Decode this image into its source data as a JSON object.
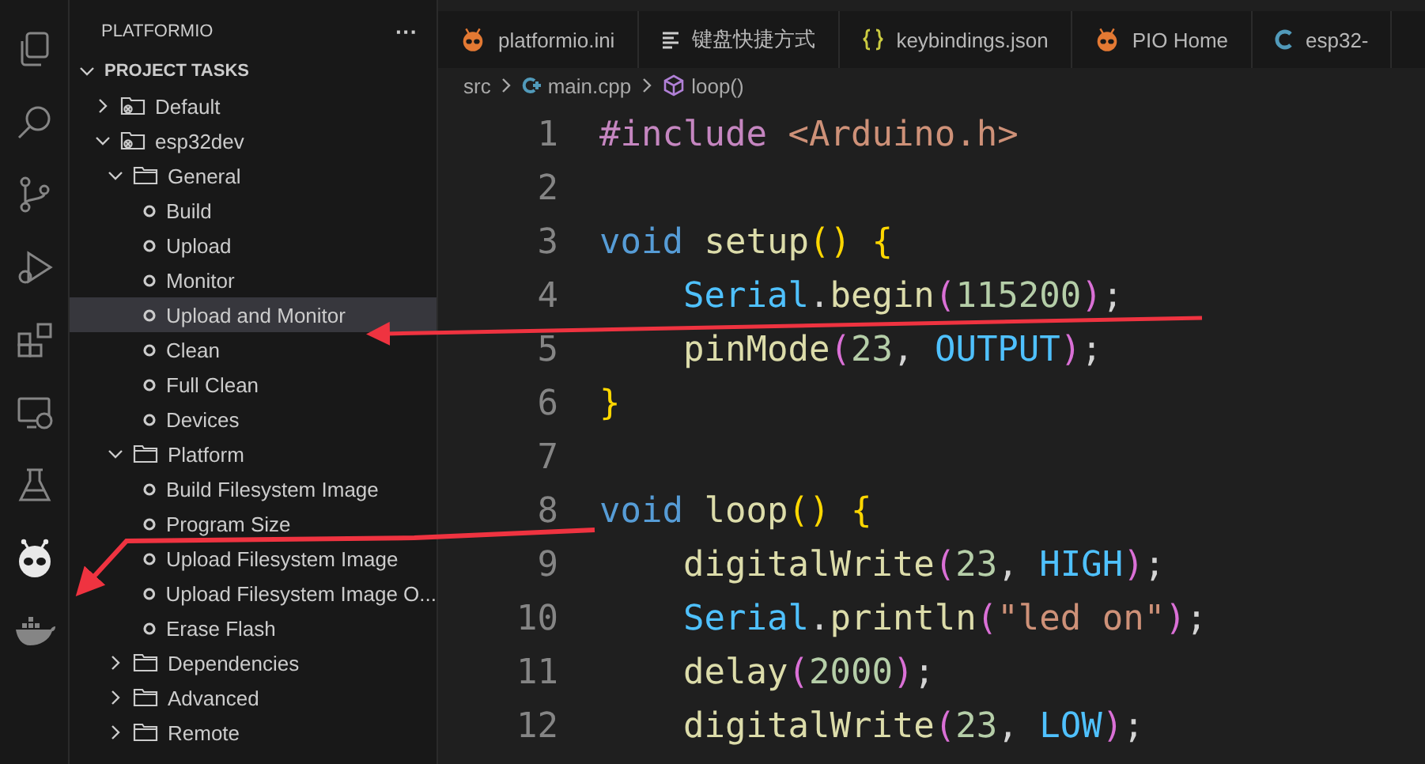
{
  "activity_bar": [
    {
      "kind": "files",
      "selected": false
    },
    {
      "kind": "search",
      "selected": false
    },
    {
      "kind": "source-control",
      "selected": false
    },
    {
      "kind": "run-debug",
      "selected": false
    },
    {
      "kind": "extensions",
      "selected": false
    },
    {
      "kind": "remote",
      "selected": false
    },
    {
      "kind": "testing",
      "selected": false
    },
    {
      "kind": "platformio",
      "selected": true
    },
    {
      "kind": "docker",
      "selected": false
    }
  ],
  "sidebar": {
    "title": "PLATFORMIO",
    "more": "···",
    "section": {
      "label": "PROJECT TASKS",
      "expanded": true
    },
    "tree": [
      {
        "kind": "env",
        "label": "Default",
        "expanded": false,
        "selected": false
      },
      {
        "kind": "env",
        "label": "esp32dev",
        "expanded": true,
        "selected": false,
        "children": [
          {
            "kind": "folder",
            "label": "General",
            "expanded": true,
            "selected": false,
            "children": [
              {
                "kind": "task",
                "label": "Build",
                "selected": false
              },
              {
                "kind": "task",
                "label": "Upload",
                "selected": false
              },
              {
                "kind": "task",
                "label": "Monitor",
                "selected": false
              },
              {
                "kind": "task",
                "label": "Upload and Monitor",
                "selected": true
              },
              {
                "kind": "task",
                "label": "Clean",
                "selected": false
              },
              {
                "kind": "task",
                "label": "Full Clean",
                "selected": false
              },
              {
                "kind": "task",
                "label": "Devices",
                "selected": false
              }
            ]
          },
          {
            "kind": "folder",
            "label": "Platform",
            "expanded": true,
            "selected": false,
            "children": [
              {
                "kind": "task",
                "label": "Build Filesystem Image",
                "selected": false
              },
              {
                "kind": "task",
                "label": "Program Size",
                "selected": false
              },
              {
                "kind": "task",
                "label": "Upload Filesystem Image",
                "selected": false
              },
              {
                "kind": "task",
                "label": "Upload Filesystem Image O...",
                "selected": false
              },
              {
                "kind": "task",
                "label": "Erase Flash",
                "selected": false
              }
            ]
          },
          {
            "kind": "folder",
            "label": "Dependencies",
            "expanded": false,
            "selected": false
          },
          {
            "kind": "folder",
            "label": "Advanced",
            "expanded": false,
            "selected": false
          },
          {
            "kind": "folder",
            "label": "Remote",
            "expanded": false,
            "selected": false
          }
        ]
      }
    ]
  },
  "tabs": [
    {
      "kind": "pio",
      "label": "platformio.ini"
    },
    {
      "kind": "list",
      "label": "键盘快捷方式"
    },
    {
      "kind": "json",
      "label": "keybindings.json"
    },
    {
      "kind": "pio",
      "label": "PIO Home"
    },
    {
      "kind": "c",
      "label": "esp32-"
    }
  ],
  "breadcrumb": [
    {
      "kind": "folder",
      "label": "src"
    },
    {
      "kind": "cpp",
      "label": "main.cpp"
    },
    {
      "kind": "symbol",
      "label": "loop()"
    }
  ],
  "code": [
    {
      "number": "1",
      "tokens": [
        {
          "kind": "directive",
          "text": "#include"
        },
        {
          "kind": "string",
          "text": " <Arduino.h>"
        }
      ]
    },
    {
      "number": "2"
    },
    {
      "number": "3",
      "tokens": [
        {
          "kind": "keyword",
          "text": "void"
        },
        {
          "kind": "function",
          "text": " setup"
        },
        {
          "kind": "bracket",
          "text": "()"
        },
        {
          "kind": "bracket",
          "text": " {"
        }
      ]
    },
    {
      "number": "4",
      "tokens": [
        {
          "kind": "class",
          "text": "    Serial"
        },
        {
          "kind": "plain",
          "text": "."
        },
        {
          "kind": "function",
          "text": "begin"
        },
        {
          "kind": "bracket2",
          "text": "("
        },
        {
          "kind": "number",
          "text": "115200"
        },
        {
          "kind": "bracket2",
          "text": ")"
        },
        {
          "kind": "plain",
          "text": ";"
        }
      ]
    },
    {
      "number": "5",
      "tokens": [
        {
          "kind": "function",
          "text": "    pinMode"
        },
        {
          "kind": "bracket2",
          "text": "("
        },
        {
          "kind": "number",
          "text": "23"
        },
        {
          "kind": "plain",
          "text": ","
        },
        {
          "kind": "constant",
          "text": " OUTPUT"
        },
        {
          "kind": "bracket2",
          "text": ")"
        },
        {
          "kind": "plain",
          "text": ";"
        }
      ]
    },
    {
      "number": "6",
      "tokens": [
        {
          "kind": "bracket",
          "text": "}"
        }
      ]
    },
    {
      "number": "7"
    },
    {
      "number": "8",
      "tokens": [
        {
          "kind": "keyword",
          "text": "void"
        },
        {
          "kind": "function",
          "text": " loop"
        },
        {
          "kind": "bracket",
          "text": "()"
        },
        {
          "kind": "bracket",
          "text": " {"
        }
      ]
    },
    {
      "number": "9",
      "tokens": [
        {
          "kind": "function",
          "text": "    digitalWrite"
        },
        {
          "kind": "bracket2",
          "text": "("
        },
        {
          "kind": "number",
          "text": "23"
        },
        {
          "kind": "plain",
          "text": ","
        },
        {
          "kind": "constant",
          "text": " HIGH"
        },
        {
          "kind": "bracket2",
          "text": ")"
        },
        {
          "kind": "plain",
          "text": ";"
        }
      ]
    },
    {
      "number": "10",
      "tokens": [
        {
          "kind": "class",
          "text": "    Serial"
        },
        {
          "kind": "plain",
          "text": "."
        },
        {
          "kind": "function",
          "text": "println"
        },
        {
          "kind": "bracket2",
          "text": "("
        },
        {
          "kind": "string",
          "text": "\"led on\""
        },
        {
          "kind": "bracket2",
          "text": ")"
        },
        {
          "kind": "plain",
          "text": ";"
        }
      ]
    },
    {
      "number": "11",
      "tokens": [
        {
          "kind": "function",
          "text": "    delay"
        },
        {
          "kind": "bracket2",
          "text": "("
        },
        {
          "kind": "number",
          "text": "2000"
        },
        {
          "kind": "bracket2",
          "text": ")"
        },
        {
          "kind": "plain",
          "text": ";"
        }
      ]
    },
    {
      "number": "12",
      "tokens": [
        {
          "kind": "function",
          "text": "    digitalWrite"
        },
        {
          "kind": "bracket2",
          "text": "("
        },
        {
          "kind": "number",
          "text": "23"
        },
        {
          "kind": "plain",
          "text": ","
        },
        {
          "kind": "constant",
          "text": " LOW"
        },
        {
          "kind": "bracket2",
          "text": ")"
        },
        {
          "kind": "plain",
          "text": ";"
        }
      ]
    }
  ]
}
